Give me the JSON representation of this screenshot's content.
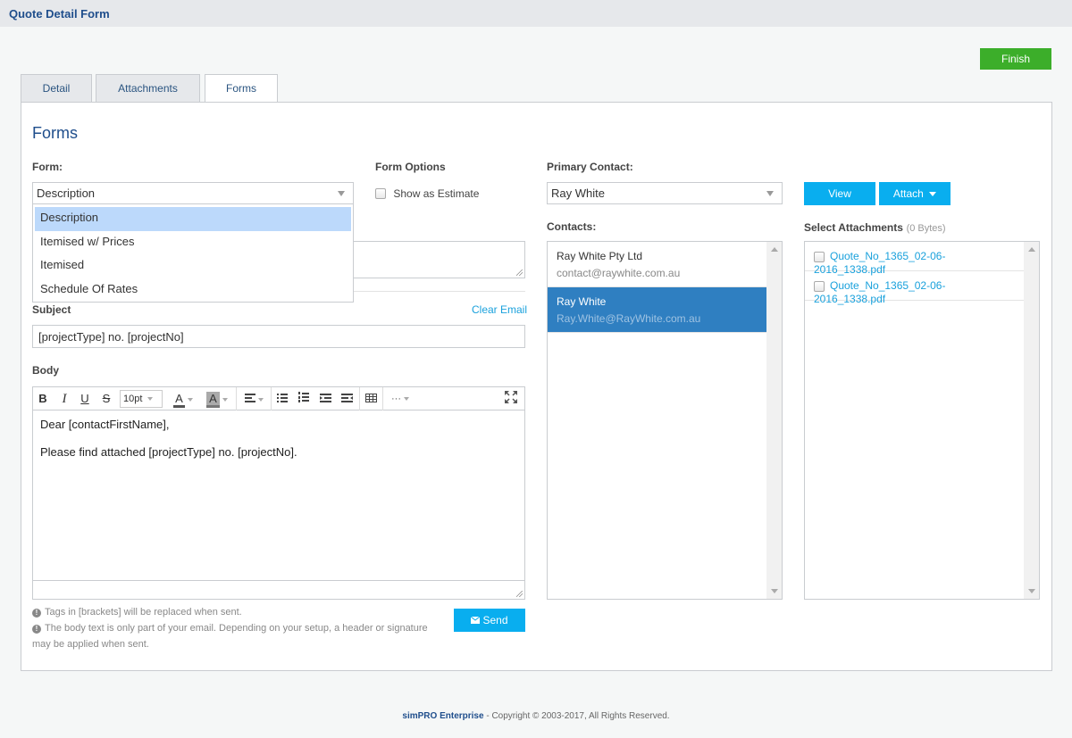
{
  "header": {
    "title": "Quote Detail Form"
  },
  "actions": {
    "finish_label": "Finish"
  },
  "tabs": [
    {
      "label": "Detail",
      "active": false
    },
    {
      "label": "Attachments",
      "active": false
    },
    {
      "label": "Forms",
      "active": true
    }
  ],
  "forms": {
    "heading": "Forms",
    "form_label": "Form:",
    "form_selected": "Description",
    "form_options": [
      "Description",
      "Itemised w/ Prices",
      "Itemised",
      "Schedule Of Rates"
    ],
    "form_options_label": "Form Options",
    "show_as_estimate_label": "Show as Estimate",
    "show_as_estimate_checked": false
  },
  "email": {
    "subject_label": "Subject",
    "clear_email_label": "Clear Email",
    "subject_value": "[projectType] no. [projectNo]",
    "body_label": "Body",
    "font_size": "10pt",
    "body_lines": [
      "Dear [contactFirstName],",
      "Please find attached [projectType] no. [projectNo]."
    ],
    "notes": [
      "Tags in [brackets] will be replaced when sent.",
      "The body text is only part of your email. Depending on your setup, a header or signature may be applied when sent."
    ],
    "send_label": "Send"
  },
  "toolbar": {
    "bold": "B",
    "italic": "I",
    "underline": "U",
    "strike": "S",
    "font_color": "A",
    "bg_color": "A",
    "more": "···"
  },
  "contacts": {
    "primary_label": "Primary Contact:",
    "primary_selected": "Ray White",
    "contacts_label": "Contacts:",
    "items": [
      {
        "name": "Ray White Pty Ltd",
        "email": "contact@raywhite.com.au",
        "selected": false
      },
      {
        "name": "Ray White",
        "email": "Ray.White@RayWhite.com.au",
        "selected": true
      }
    ]
  },
  "attachments": {
    "view_label": "View",
    "attach_label": "Attach",
    "select_label": "Select Attachments",
    "size_label": "(0 Bytes)",
    "items": [
      {
        "filename": "Quote_No_1365_02-06-2016_1338.pdf",
        "checked": false
      },
      {
        "filename": "Quote_No_1365_02-06-2016_1338.pdf",
        "checked": false
      }
    ]
  },
  "footer": {
    "brand": "simPRO Enterprise",
    "copyright": " - Copyright © 2003-2017, All Rights Reserved."
  }
}
